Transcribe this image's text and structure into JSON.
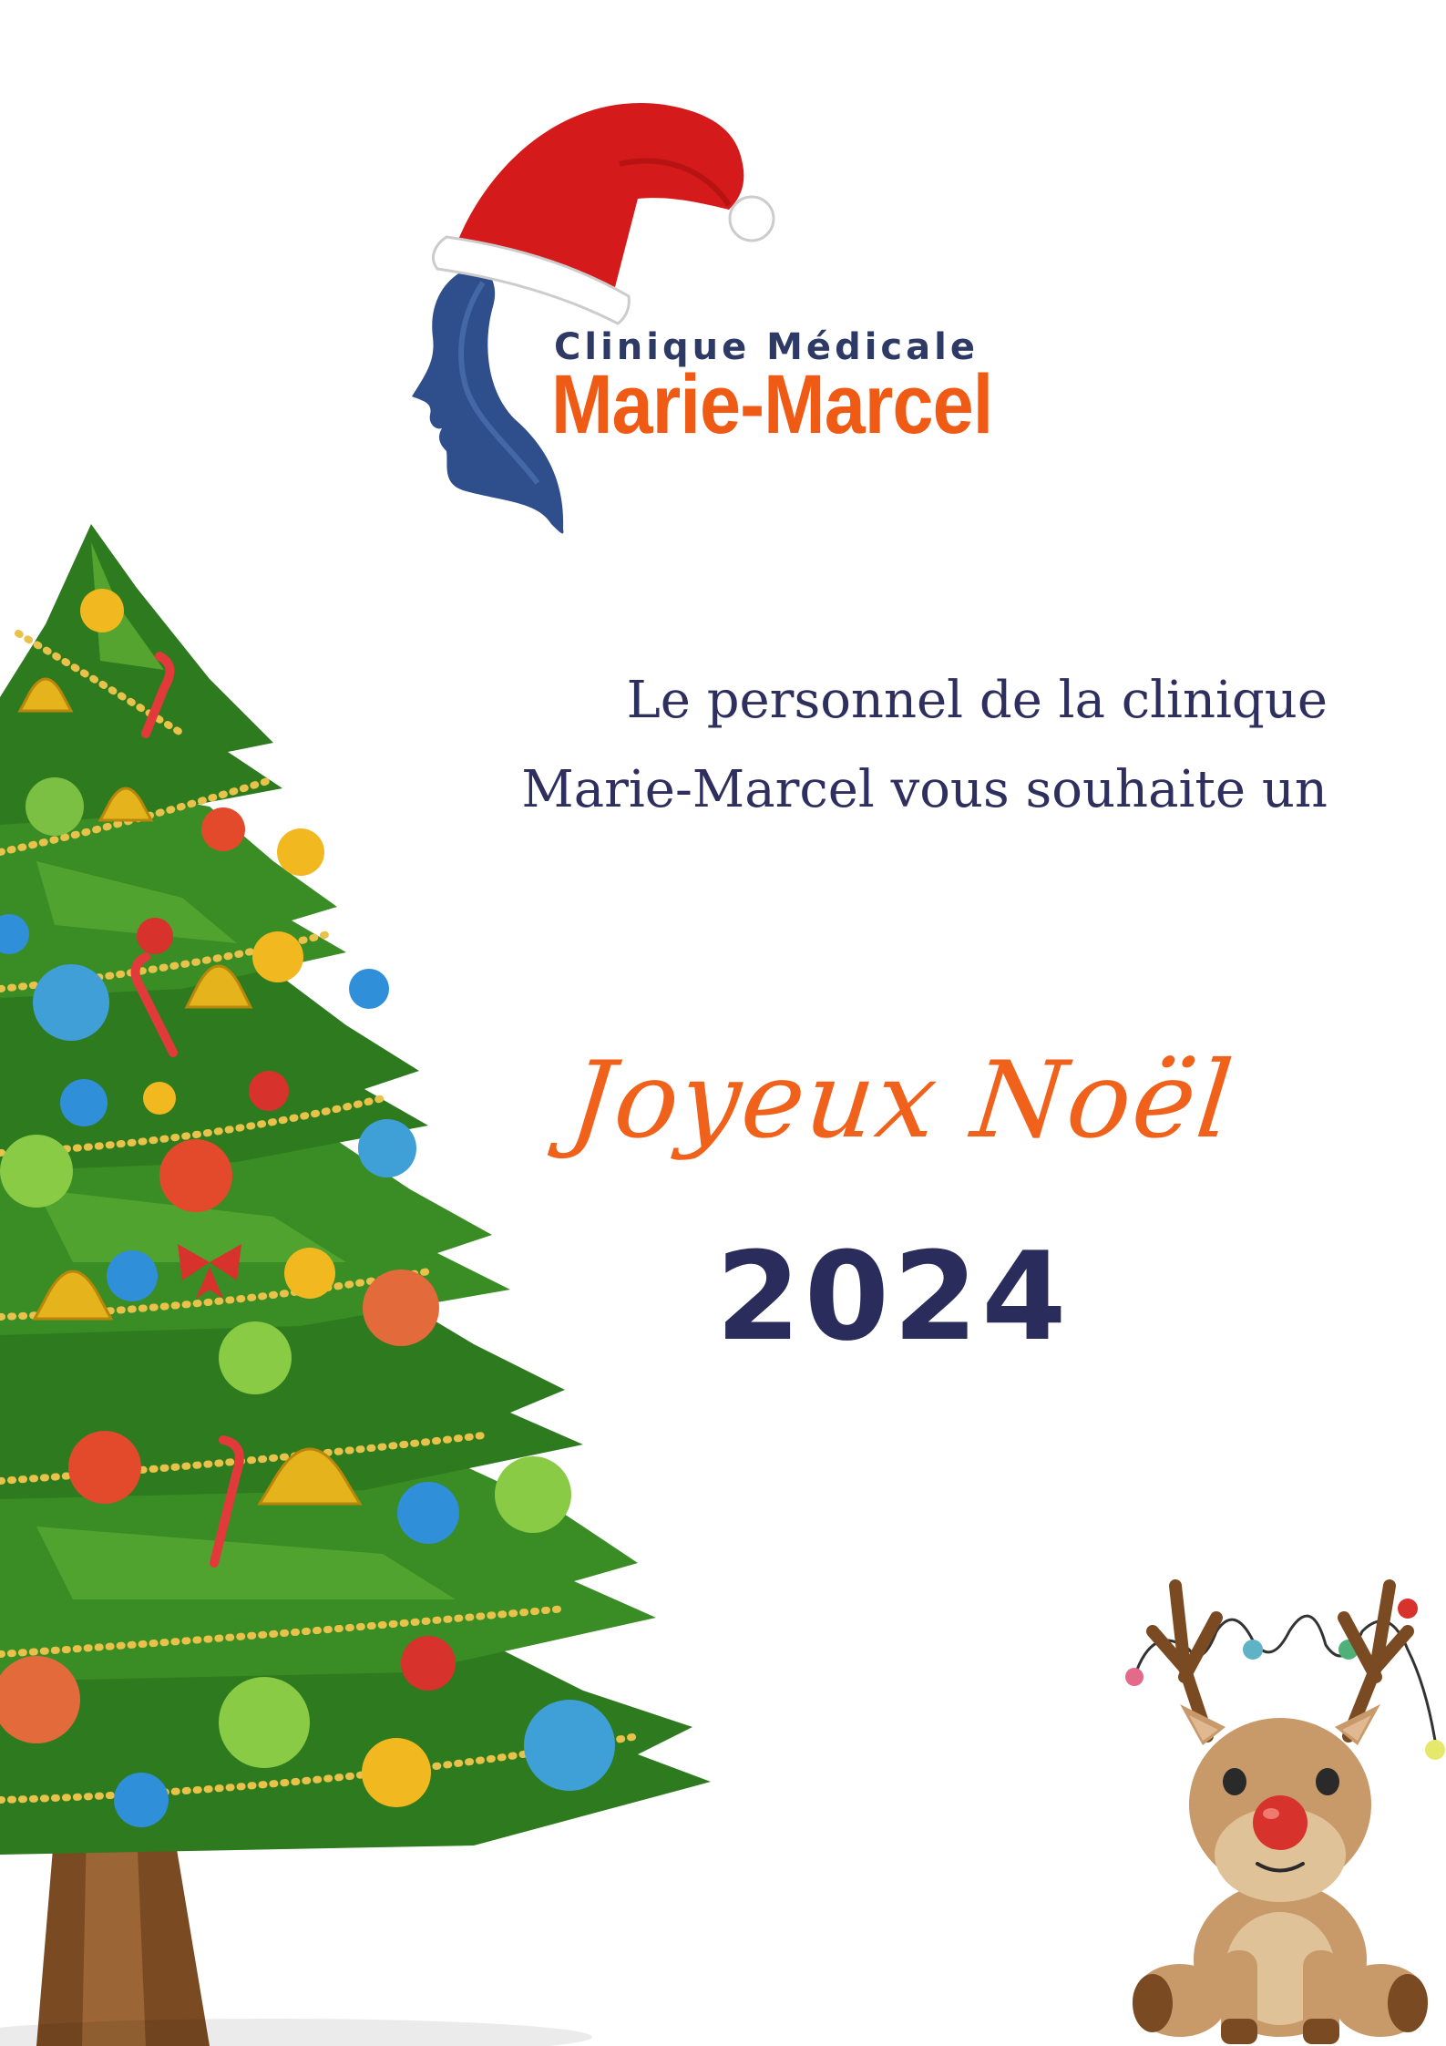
{
  "logo": {
    "line1": "Clinique Médicale",
    "line2": "Marie-Marcel",
    "hat_icon": "santa-hat-icon",
    "face_icon": "face-profile-icon",
    "colors": {
      "hat_red": "#d41a1a",
      "face_blue": "#2f4e8c",
      "name_orange": "#ef5a14",
      "text_navy": "#2e3a66"
    }
  },
  "message": {
    "line1": "Le personnel de la clinique",
    "line2": "Marie-Marcel vous souhaite un"
  },
  "greeting": {
    "title": "Joyeux Noël",
    "year": "2024"
  },
  "decorations": {
    "tree_icon": "christmas-tree-icon",
    "reindeer_icon": "reindeer-icon"
  }
}
